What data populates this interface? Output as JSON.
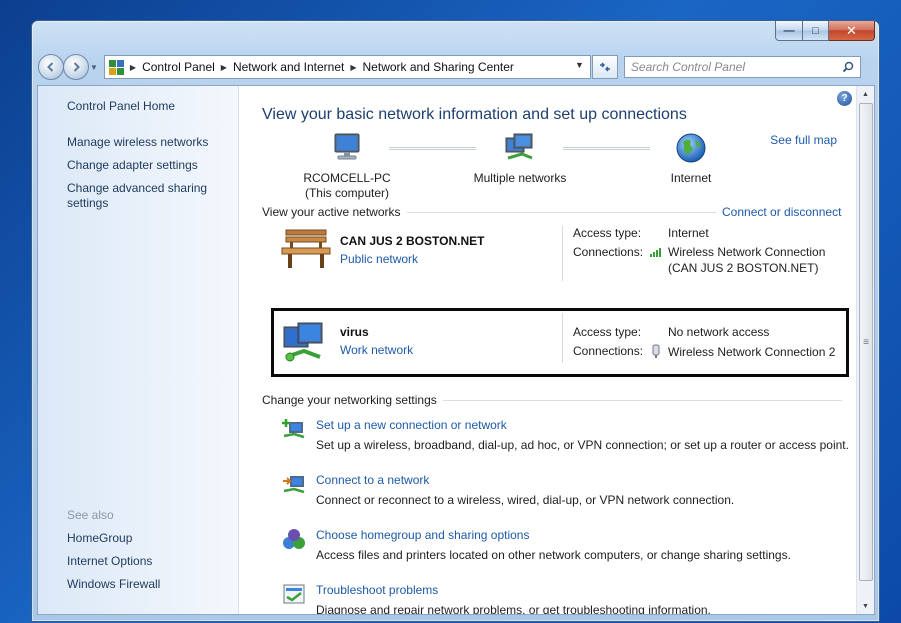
{
  "window": {
    "caption_buttons": {
      "minimize": "—",
      "maximize": "□",
      "close": "✕"
    }
  },
  "nav": {
    "breadcrumbs": [
      "Control Panel",
      "Network and Internet",
      "Network and Sharing Center"
    ],
    "search_placeholder": "Search Control Panel",
    "icons": {
      "back": "back-arrow-icon",
      "forward": "forward-arrow-icon",
      "refresh": "refresh-icon",
      "search": "search-icon"
    }
  },
  "sidebar": {
    "home": "Control Panel Home",
    "links": [
      "Manage wireless networks",
      "Change adapter settings",
      "Change advanced sharing settings"
    ],
    "see_also_heading": "See also",
    "see_also": [
      "HomeGroup",
      "Internet Options",
      "Windows Firewall"
    ]
  },
  "main": {
    "title": "View your basic network information and set up connections",
    "see_full_map": "See full map",
    "map": {
      "computer": {
        "name": "RCOMCELL-PC",
        "subtitle": "(This computer)"
      },
      "middle": {
        "name": "Multiple networks"
      },
      "internet": {
        "name": "Internet"
      }
    },
    "active_networks": {
      "heading": "View your active networks",
      "action": "Connect or disconnect",
      "access_type_label": "Access type:",
      "connections_label": "Connections:",
      "networks": [
        {
          "name": "CAN JUS 2 BOSTON.NET",
          "type": "Public network",
          "access_type": "Internet",
          "connection_line1": "Wireless Network Connection",
          "connection_line2": "(CAN JUS 2 BOSTON.NET)"
        },
        {
          "name": "virus",
          "type": "Work network",
          "access_type": "No network access",
          "connection_line1": "Wireless Network Connection 2"
        }
      ]
    },
    "settings": {
      "heading": "Change your networking settings",
      "tasks": [
        {
          "link": "Set up a new connection or network",
          "desc": "Set up a wireless, broadband, dial-up, ad hoc, or VPN connection; or set up a router or access point."
        },
        {
          "link": "Connect to a network",
          "desc": "Connect or reconnect to a wireless, wired, dial-up, or VPN network connection."
        },
        {
          "link": "Choose homegroup and sharing options",
          "desc": "Access files and printers located on other network computers, or change sharing settings."
        },
        {
          "link": "Troubleshoot problems",
          "desc": "Diagnose and repair network problems, or get troubleshooting information."
        }
      ]
    }
  },
  "colors": {
    "link": "#1d5aa8",
    "title": "#1d3f6e",
    "highlight_border": "#0a0a0a"
  }
}
